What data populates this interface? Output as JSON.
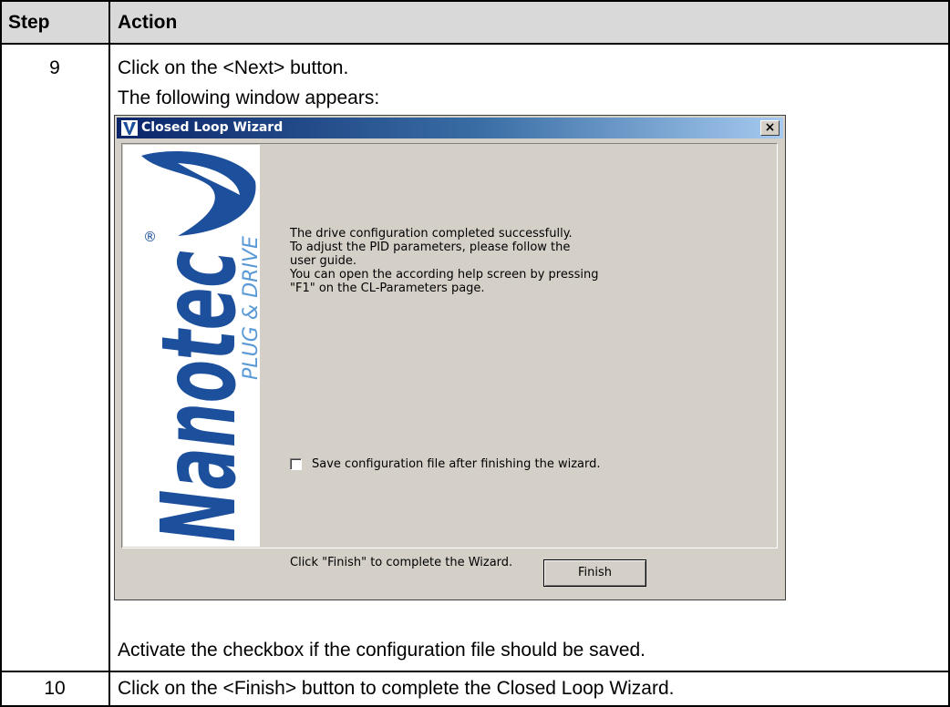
{
  "table": {
    "headers": {
      "step": "Step",
      "action": "Action"
    },
    "rows": [
      {
        "step": "9",
        "action_line1": "Click on the <Next> button.",
        "action_line2": "The following window appears:",
        "action_after": "Activate the checkbox if the configuration file should be saved."
      },
      {
        "step": "10",
        "action_line1": "Click on the <Finish> button to complete the Closed Loop Wizard."
      }
    ]
  },
  "dialog": {
    "title": "Closed Loop Wizard",
    "close_glyph": "×",
    "brand_name": "Nanotec",
    "brand_tagline": "PLUG & DRIVE",
    "registered_mark": "®",
    "message_lines": [
      "The drive configuration completed successfully.",
      "To adjust the PID parameters, please follow the",
      "user guide.",
      "You can open the according help screen by pressing",
      "\"F1\" on the CL-Parameters page."
    ],
    "checkbox": {
      "label": "Save configuration file after finishing the wizard.",
      "checked": false
    },
    "finish_hint": "Click \"Finish\" to complete the Wizard.",
    "finish_button": "Finish",
    "colors": {
      "brand_blue": "#1c4f9c",
      "tagline_blue": "#5a9ad6",
      "window_face": "#d4d0c8"
    }
  }
}
